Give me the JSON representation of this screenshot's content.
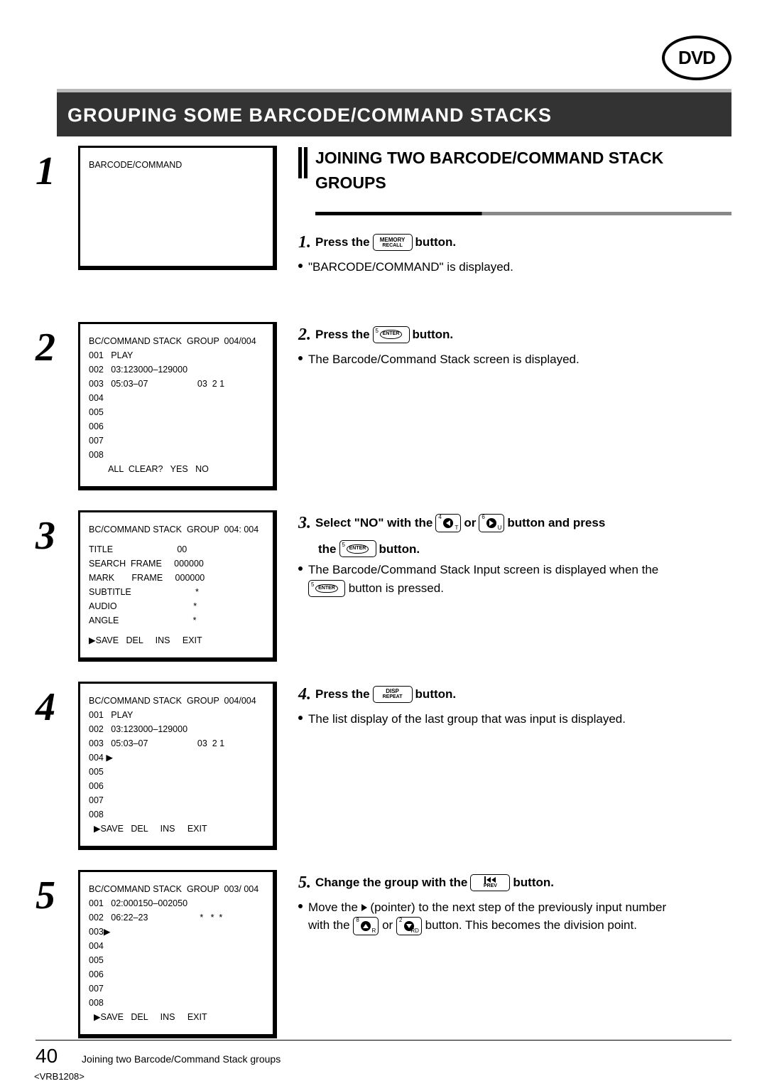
{
  "logo": "DVD",
  "title": "GROUPING SOME BARCODE/COMMAND STACKS",
  "subheading": "JOINING TWO BARCODE/COMMAND STACK GROUPS",
  "screens": {
    "s1_l1": "BARCODE/COMMAND",
    "s2_l1": "BC/COMMAND STACK  GROUP  004/004",
    "s2_l2": "001   PLAY",
    "s2_l3": "002   03:123000–129000",
    "s2_l4": "003   05:03–07                    03  2 1",
    "s2_l5": "004",
    "s2_l6": "005",
    "s2_l7": "006",
    "s2_l8": "007",
    "s2_l9": "008",
    "s2_l10": "        ALL  CLEAR?   YES   NO",
    "s3_l1": "BC/COMMAND STACK  GROUP  004: 004",
    "s3_l2": "TITLE                          00",
    "s3_l3": "SEARCH  FRAME     000000",
    "s3_l4": "MARK       FRAME     000000",
    "s3_l5": "SUBTITLE                          *",
    "s3_l6": "AUDIO                               *",
    "s3_l7": "ANGLE                              *",
    "s3_l8": "▶SAVE   DEL     INS     EXIT",
    "s4_l1": "BC/COMMAND STACK  GROUP  004/004",
    "s4_l2": "001   PLAY",
    "s4_l3": "002   03:123000–129000",
    "s4_l4": "003   05:03–07                    03  2 1",
    "s4_l5": "004 ▶",
    "s4_l6": "005",
    "s4_l7": "006",
    "s4_l8": "007",
    "s4_l9": "008",
    "s4_l10": "  ▶SAVE   DEL     INS     EXIT",
    "s5_l1": "BC/COMMAND STACK  GROUP  003/ 004",
    "s5_l2": "001   02:000150–002050",
    "s5_l3": "002   06:22–23                     *   *  *",
    "s5_l4": "003▶",
    "s5_l5": "004",
    "s5_l6": "005",
    "s5_l7": "006",
    "s5_l8": "007",
    "s5_l9": "008",
    "s5_l10": "  ▶SAVE   DEL     INS     EXIT"
  },
  "steps": {
    "n1": "1",
    "n2": "2",
    "n3": "3",
    "n4": "4",
    "n5": "5"
  },
  "instr": {
    "i1a": "1.",
    "i1b": "Press the",
    "i1c": "button.",
    "i1_bullet": "\"BARCODE/COMMAND\" is displayed.",
    "i2a": "2.",
    "i2b": "Press the",
    "i2c": "button.",
    "i2_bullet": "The Barcode/Command Stack screen is displayed.",
    "i3a": "3.",
    "i3b": "Select \"NO\" with the",
    "i3c": "or",
    "i3d": "button and press",
    "i3e": "the",
    "i3f": "button.",
    "i3_bullet_a": "The Barcode/Command Stack Input screen is displayed when the",
    "i3_bullet_b": "button is pressed.",
    "i4a": "4.",
    "i4b": "Press the",
    "i4c": "button.",
    "i4_bullet": "The list display of the last group that was input is displayed.",
    "i5a": "5.",
    "i5b": "Change the group with the",
    "i5c": "button.",
    "i5_bullet_a": "Move the",
    "i5_bullet_b": "(pointer) to the next step of the previously input number",
    "i5_bullet_c": "with the",
    "i5_bullet_d": "or",
    "i5_bullet_e": "button. This becomes the division point."
  },
  "btns": {
    "memory1": "MEMORY",
    "memory2": "RECALL",
    "enter": "ENTER",
    "disp1": "DISP",
    "disp2": "REPEAT",
    "prev": "PREV",
    "sup4": "4",
    "sub_t": "T",
    "sup6": "6",
    "sub_u": "U",
    "sup5": "5",
    "sup8": "8",
    "sub_r": "R",
    "sup2": "2",
    "sub_rd": "RD"
  },
  "footer": {
    "page": "40",
    "caption": "Joining two Barcode/Command Stack groups",
    "docid": "<VRB1208>"
  }
}
